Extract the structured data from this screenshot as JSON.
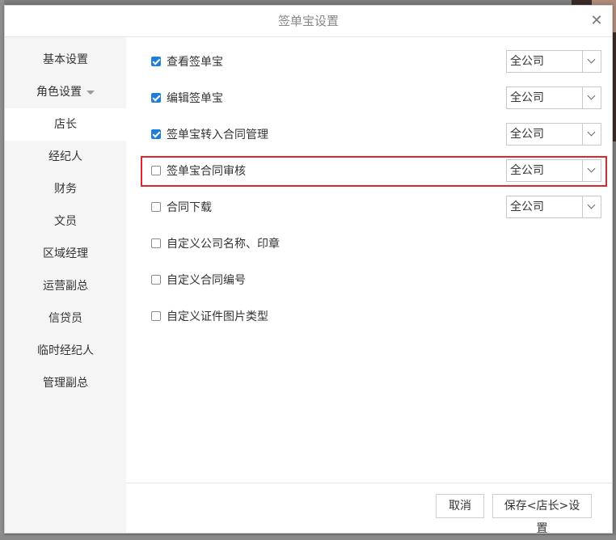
{
  "dialog": {
    "title": "签单宝设置",
    "close_icon": "close-icon"
  },
  "sidebar": {
    "items": [
      {
        "label": "基本设置"
      },
      {
        "label": "角色设置",
        "icon": "caret-down-icon"
      },
      {
        "label": "店长",
        "active": true
      },
      {
        "label": "经纪人"
      },
      {
        "label": "财务"
      },
      {
        "label": "文员"
      },
      {
        "label": "区域经理"
      },
      {
        "label": "运营副总"
      },
      {
        "label": "信贷员"
      },
      {
        "label": "临时经纪人"
      },
      {
        "label": "管理副总"
      }
    ]
  },
  "permissions": [
    {
      "label": "查看签单宝",
      "checked": true,
      "scope": "全公司"
    },
    {
      "label": "编辑签单宝",
      "checked": true,
      "scope": "全公司"
    },
    {
      "label": "签单宝转入合同管理",
      "checked": true,
      "scope": "全公司"
    },
    {
      "label": "签单宝合同审核",
      "checked": false,
      "scope": "全公司",
      "highlighted": true
    },
    {
      "label": "合同下载",
      "checked": false,
      "scope": "全公司"
    },
    {
      "label": "自定义公司名称、印章",
      "checked": false
    },
    {
      "label": "自定义合同编号",
      "checked": false
    },
    {
      "label": "自定义证件图片类型",
      "checked": false
    }
  ],
  "footer": {
    "cancel_label": "取消",
    "save_label": "保存<店长>设置"
  },
  "colors": {
    "accent": "#1e7fd8",
    "highlight": "#e0262b"
  }
}
